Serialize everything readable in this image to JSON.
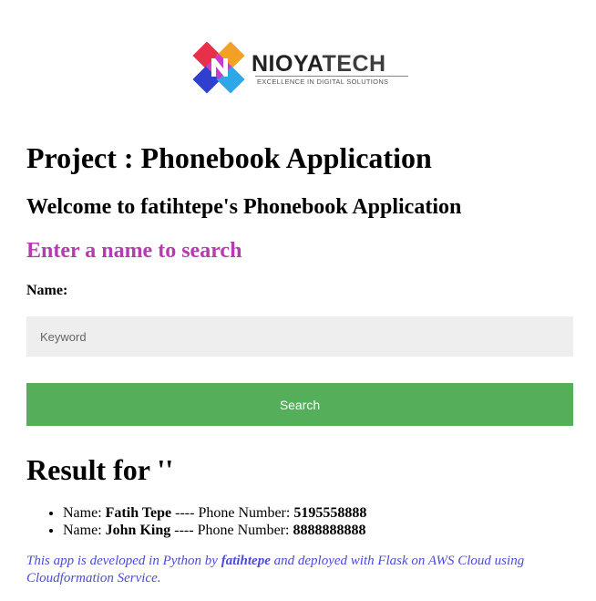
{
  "logo": {
    "name_primary": "NIOYA",
    "name_secondary": "TECH",
    "tagline": "EXCELLENCE IN DIGITAL SOLUTIONS",
    "colors": [
      "#e8304b",
      "#f3a126",
      "#2f3fcf",
      "#2fa6e8",
      "#c93ad0"
    ]
  },
  "page": {
    "title": "Project : Phonebook Application",
    "welcome": "Welcome to fatihtepe's Phonebook Application",
    "search_heading": "Enter a name to search",
    "search_heading_color": "#b63bb0"
  },
  "form": {
    "name_label": "Name:",
    "keyword_placeholder": "Keyword",
    "keyword_value": "",
    "search_label": "Search",
    "button_color": "#55ae5a"
  },
  "results": {
    "heading": "Result for ''",
    "items": [
      {
        "name_label": "Name:",
        "name": "Fatih Tepe",
        "separator": "----",
        "phone_label": "Phone Number:",
        "phone": "5195558888"
      },
      {
        "name_label": "Name:",
        "name": "John King",
        "separator": "----",
        "phone_label": "Phone Number:",
        "phone": "8888888888"
      }
    ]
  },
  "footer": {
    "text_before": "This app is developed in Python by",
    "author": "fatihtepe",
    "text_after": "and deployed with Flask on AWS Cloud using Cloudformation Service.",
    "color": "#4b4bd8"
  }
}
